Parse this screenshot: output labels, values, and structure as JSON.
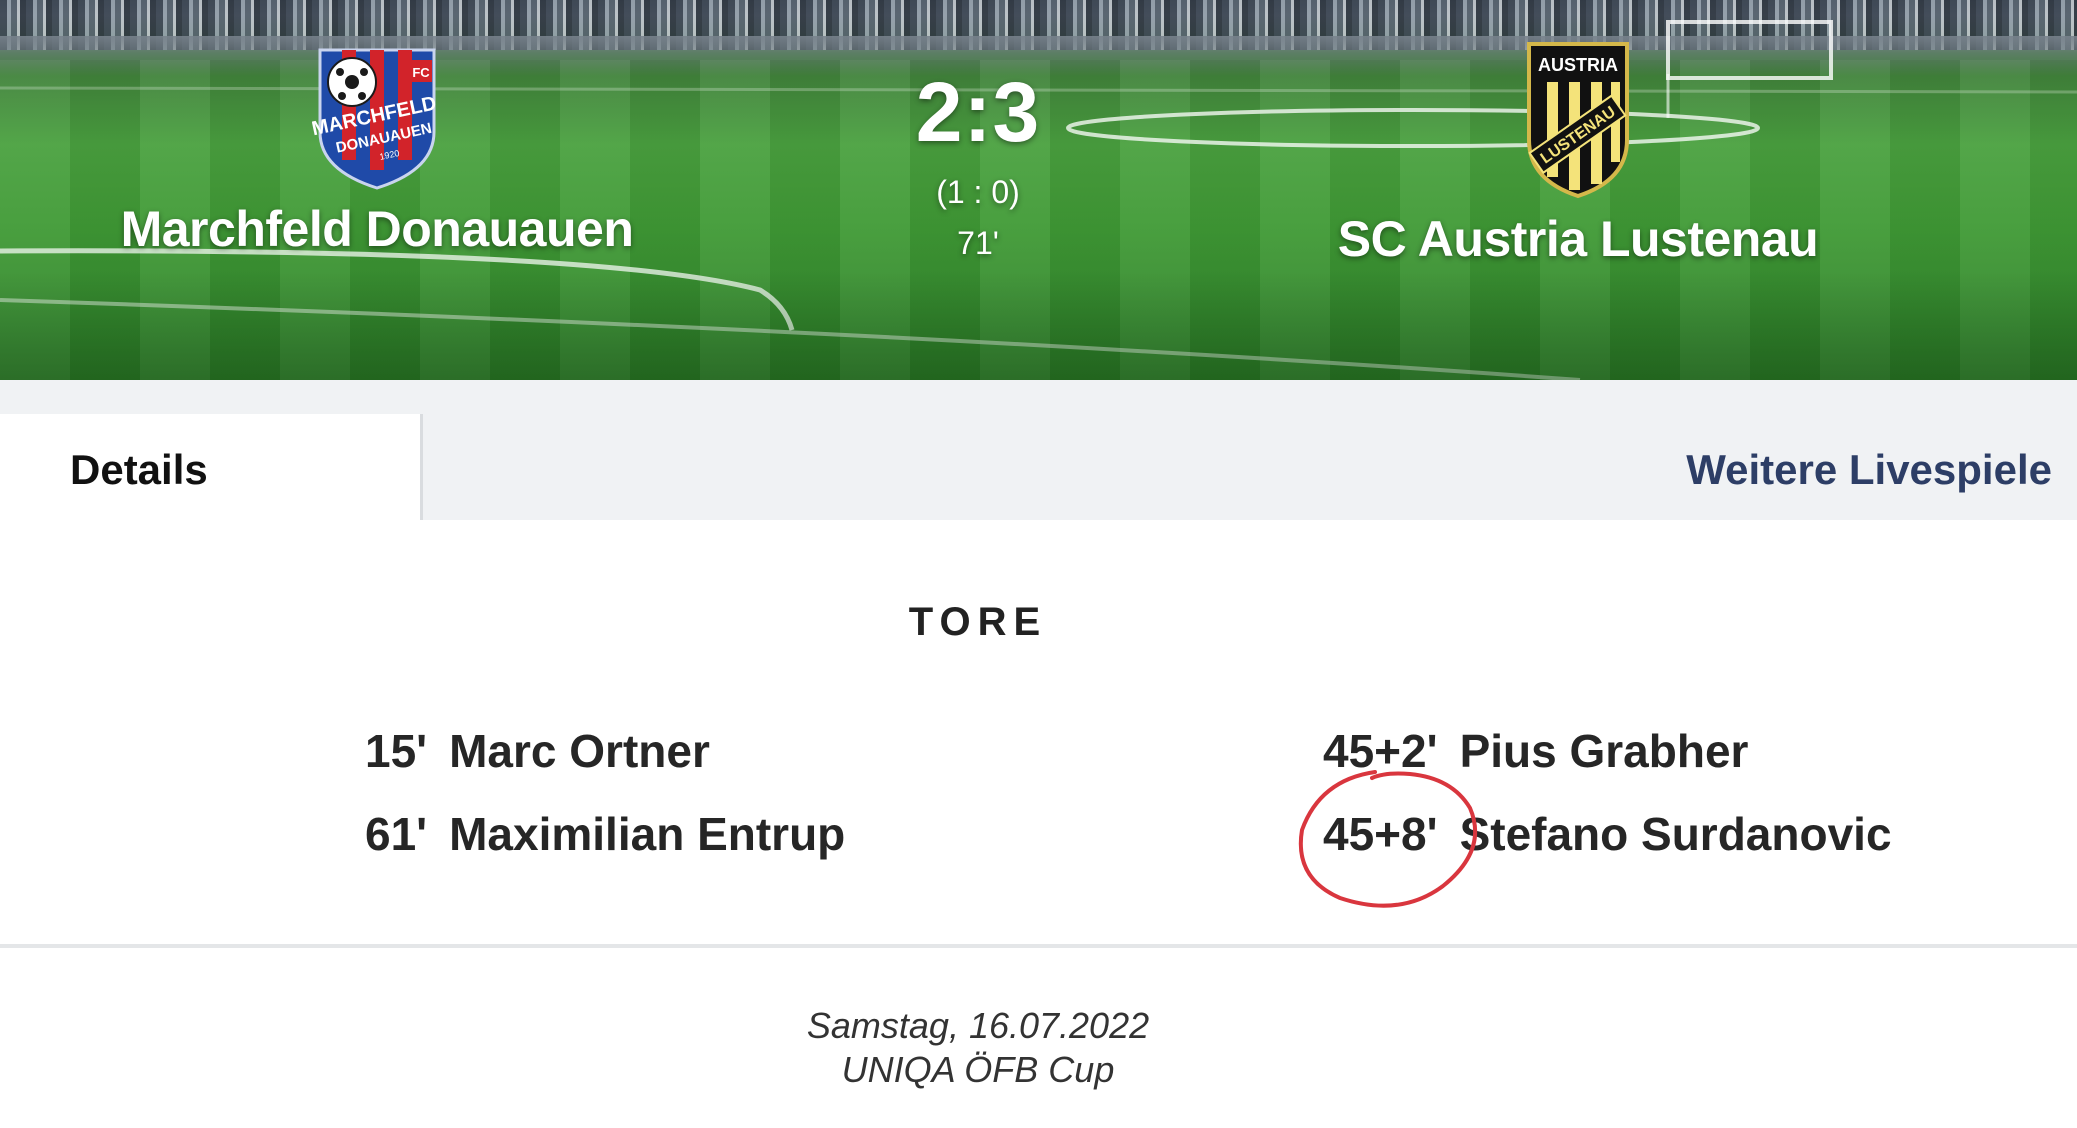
{
  "match": {
    "home": {
      "name": "Marchfeld Donauauen",
      "crest_text": [
        "FC",
        "MARCHFELD",
        "DONAUAUEN",
        "1920"
      ]
    },
    "away": {
      "name": "SC Austria Lustenau",
      "crest_text": [
        "AUSTRIA",
        "LUSTENAU"
      ]
    },
    "score": "2:3",
    "halftime": "(1 : 0)",
    "minute": "71'"
  },
  "tabs": {
    "details": "Details",
    "more": "Weitere Livespiele"
  },
  "goals": {
    "title": "TORE",
    "home": [
      {
        "minute": "15'",
        "player": "Marc Ortner"
      },
      {
        "minute": "61'",
        "player": "Maximilian Entrup"
      }
    ],
    "away": [
      {
        "minute": "45+2'",
        "player": "Pius Grabher"
      },
      {
        "minute": "45+8'",
        "player": "Stefano Surdanovic"
      }
    ]
  },
  "footer": {
    "date": "Samstag, 16.07.2022",
    "competition": "UNIQA ÖFB Cup"
  },
  "colors": {
    "link": "#2d3e66",
    "annotation": "#d9363e",
    "pitch": "#3f9a35"
  }
}
